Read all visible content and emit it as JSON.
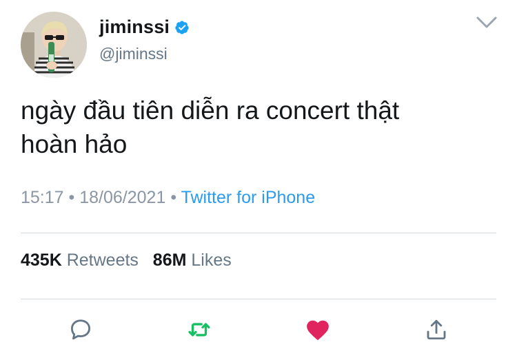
{
  "user": {
    "display_name": "jiminssi",
    "handle": "@jiminssi",
    "verified_icon": "verified-badge-icon"
  },
  "tweet": {
    "text_line1": "ngày đầu tiên diễn ra concert thật",
    "text_line2": "hoàn hảo",
    "time": "15:17",
    "separator": "•",
    "date": "18/06/2021",
    "source": "Twitter for iPhone"
  },
  "stats": {
    "retweets_count": "435K",
    "retweets_label": "Retweets",
    "likes_count": "86M",
    "likes_label": "Likes"
  },
  "actions": [
    "reply-icon",
    "retweet-icon",
    "like-icon",
    "share-icon"
  ],
  "colors": {
    "link": "#2b9bf0",
    "retweet_green": "#17bf63",
    "like_red": "#e0245e",
    "icon_gray": "#657786",
    "verified_blue": "#1da1f2"
  }
}
